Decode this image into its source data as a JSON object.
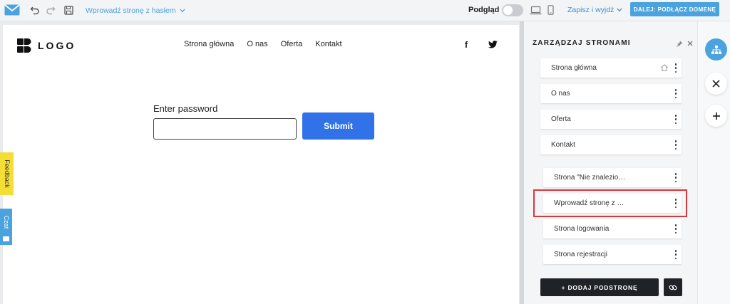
{
  "toolbar": {
    "current_page": "Wprowadź stronę z hasłem",
    "preview_label": "Podgląd",
    "save_exit_label": "Zapisz i wyjdź",
    "next_button_label": "DALEJ: PODŁĄCZ DOMENĘ",
    "preview_toggle_on": false
  },
  "site": {
    "logo_text": "LOGO",
    "nav": [
      "Strona główna",
      "O nas",
      "Oferta",
      "Kontakt"
    ],
    "social": {
      "facebook": "f"
    },
    "password_label": "Enter password",
    "password_value": "",
    "submit_label": "Submit"
  },
  "side_tabs": {
    "feedback": "Feedback",
    "chat": "Czat"
  },
  "panel": {
    "title": "ZARZĄDZAJ STRONAMI",
    "pages": [
      {
        "label": "Strona główna",
        "home": true
      },
      {
        "label": "O nas"
      },
      {
        "label": "Oferta"
      },
      {
        "label": "Kontakt"
      }
    ],
    "special_pages": [
      {
        "label": "Strona \"Nie znalezio…"
      },
      {
        "label": "Wprowadź stronę z …",
        "selected": true
      },
      {
        "label": "Strona logowania"
      },
      {
        "label": "Strona rejestracji"
      }
    ],
    "add_button_label": "+ DODAJ PODSTRONĘ"
  },
  "colors": {
    "accent": "#4aa3df",
    "submit": "#3272e8",
    "highlight": "#d9383a",
    "feedback_tab": "#f4de36",
    "dark_button": "#1f2328"
  },
  "icons": {
    "undo": "undo-icon",
    "redo": "redo-icon",
    "save": "floppy-icon",
    "desktop": "laptop-icon",
    "mobile": "phone-icon",
    "rail": [
      "sitemap-icon",
      "close-icon",
      "plus-icon"
    ]
  }
}
